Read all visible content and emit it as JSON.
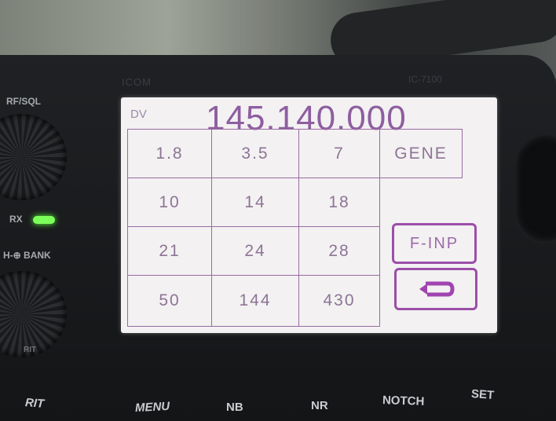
{
  "brand": "ICOM",
  "model": "IC-7100",
  "display": {
    "mode": "DV",
    "frequency": "145.140.000",
    "bands": [
      [
        "1.8",
        "3.5",
        "7"
      ],
      [
        "10",
        "14",
        "18"
      ],
      [
        "21",
        "24",
        "28"
      ],
      [
        "50",
        "144",
        "430"
      ]
    ],
    "gene_label": "GENE",
    "finp_label": "F-INP"
  },
  "controls": {
    "rf_sql": "RF/SQL",
    "rx": "RX",
    "bank": "H-⊕ BANK",
    "rit_small": "RIT",
    "bottom_buttons": [
      "RIT",
      "MENU",
      "NB",
      "NR",
      "NOTCH",
      "SET"
    ]
  }
}
